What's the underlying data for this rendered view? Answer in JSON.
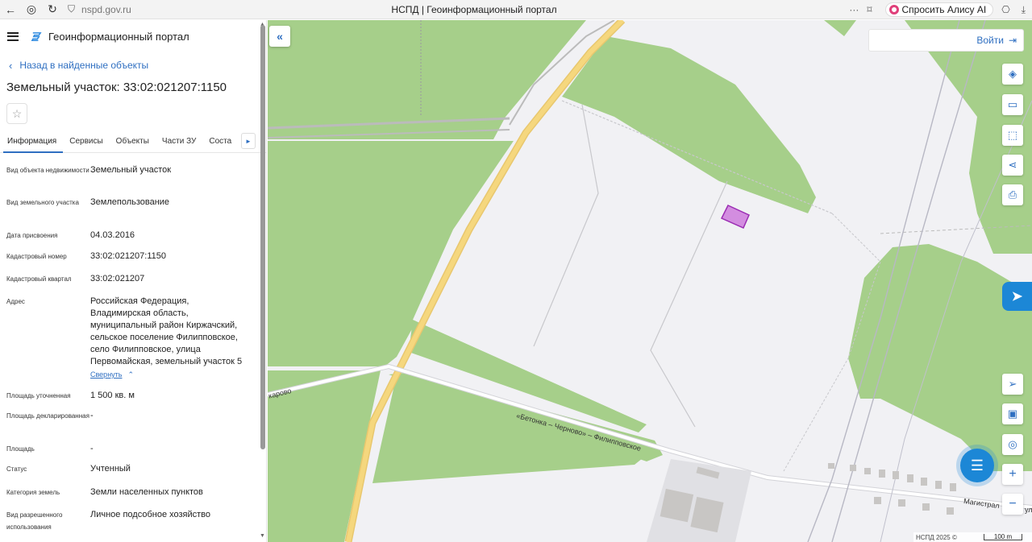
{
  "browser": {
    "url": "nspd.gov.ru",
    "tab_title": "НСПД | Геоинформационный портал",
    "alice_label": "Спросить Алису AI",
    "more": "···"
  },
  "sidebar": {
    "portal_title": "Геоинформационный портал",
    "back_label": "Назад в найденные объекты",
    "parcel_title": "Земельный участок: 33:02:021207:1150",
    "tabs": [
      "Информация",
      "Сервисы",
      "Объекты",
      "Части ЗУ",
      "Соста"
    ],
    "properties": [
      {
        "key": "Вид объекта недвижимости",
        "value": "Земельный участок"
      },
      {
        "key": "Вид земельного участка",
        "value": "Землепользование"
      },
      {
        "key": "Дата присвоения",
        "value": "04.03.2016"
      },
      {
        "key": "Кадастровый номер",
        "value": "33:02:021207:1150"
      },
      {
        "key": "Кадастровый квартал",
        "value": "33:02:021207"
      },
      {
        "key": "Адрес",
        "value": "Российская Федерация, Владимирская область, муниципальный район Киржачский, сельское поселение Филипповское, село Филипповское, улица Первомайская, земельный участок 5"
      },
      {
        "key": "Площадь уточненная",
        "value": "1 500 кв. м"
      },
      {
        "key": "Площадь декларированная",
        "value": "-"
      },
      {
        "key": "Площадь",
        "value": "-"
      },
      {
        "key": "Статус",
        "value": "Учтенный"
      },
      {
        "key": "Категория земель",
        "value": "Земли населенных пунктов"
      },
      {
        "key": "Вид разрешенного использования",
        "value": "Личное подсобное хозяйство"
      }
    ],
    "collapse_label": "Свернуть"
  },
  "map": {
    "login_label": "Войти",
    "road_label": "«Бетонка – Черново» – Филипповское",
    "left_label": "карово",
    "right_label": "Магистрал",
    "right_label_2": "ул",
    "attribution": "НСПД 2025 ©",
    "scale": "100 m",
    "colors": {
      "green": "#a6cf8a",
      "road": "#f5d77e",
      "parcel": "#d38de0"
    }
  }
}
